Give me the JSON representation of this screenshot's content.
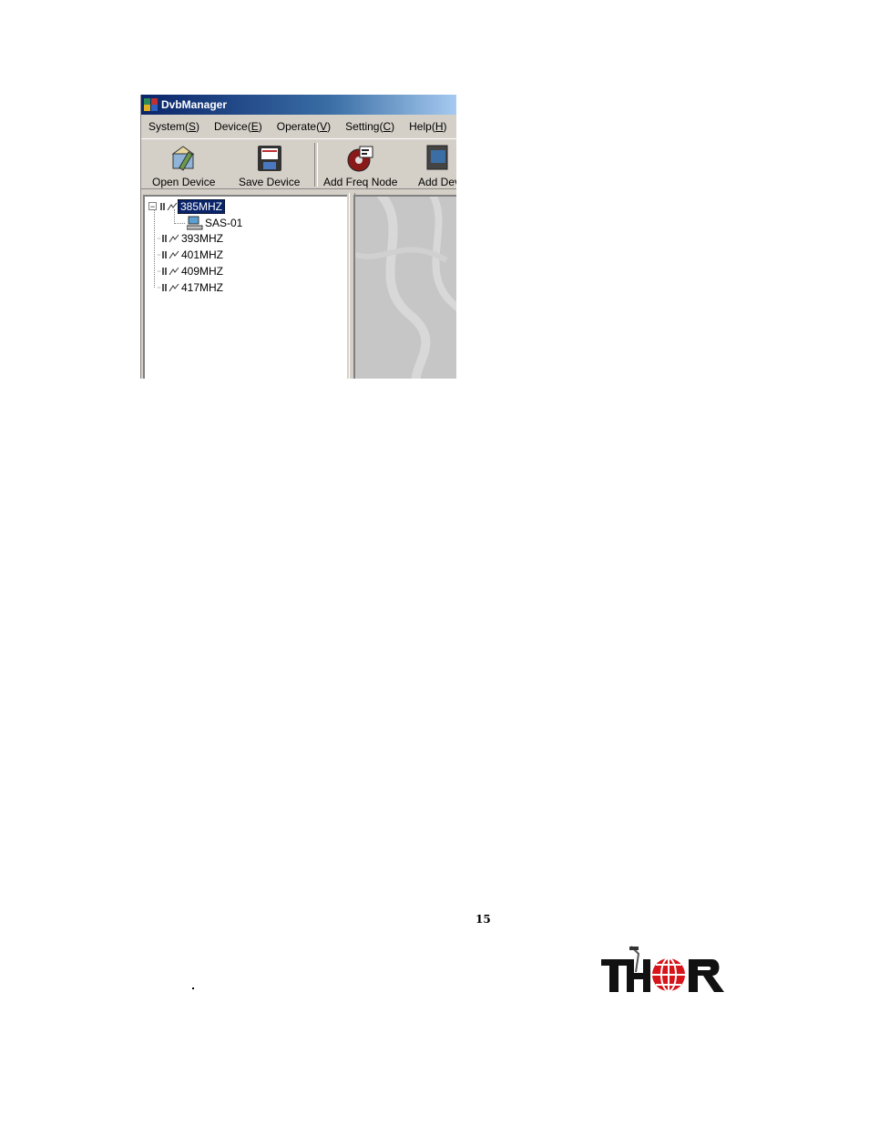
{
  "window": {
    "title": "DvbManager",
    "menu": [
      {
        "label": "System(",
        "key": "S",
        "close": ")"
      },
      {
        "label": "Device(",
        "key": "E",
        "close": ")"
      },
      {
        "label": "Operate(",
        "key": "V",
        "close": ")"
      },
      {
        "label": "Setting(",
        "key": "C",
        "close": ")"
      },
      {
        "label": "Help(",
        "key": "H",
        "close": ")"
      }
    ],
    "toolbar": {
      "open_device": "Open Device",
      "save_device": "Save Device",
      "add_freq_node": "Add Freq Node",
      "add_device": "Add Dev"
    },
    "tree": {
      "nodes": [
        {
          "label": "385MHZ",
          "selected": true,
          "expanded": true,
          "children": [
            {
              "label": "SAS-01"
            }
          ]
        },
        {
          "label": "393MHZ"
        },
        {
          "label": "401MHZ"
        },
        {
          "label": "409MHZ"
        },
        {
          "label": "417MHZ"
        }
      ]
    }
  },
  "page": {
    "number": "15",
    "logo_text": "THOR"
  },
  "colors": {
    "title_bar": "#0a246a",
    "selection": "#0a246a",
    "logo_red": "#d7141a"
  }
}
